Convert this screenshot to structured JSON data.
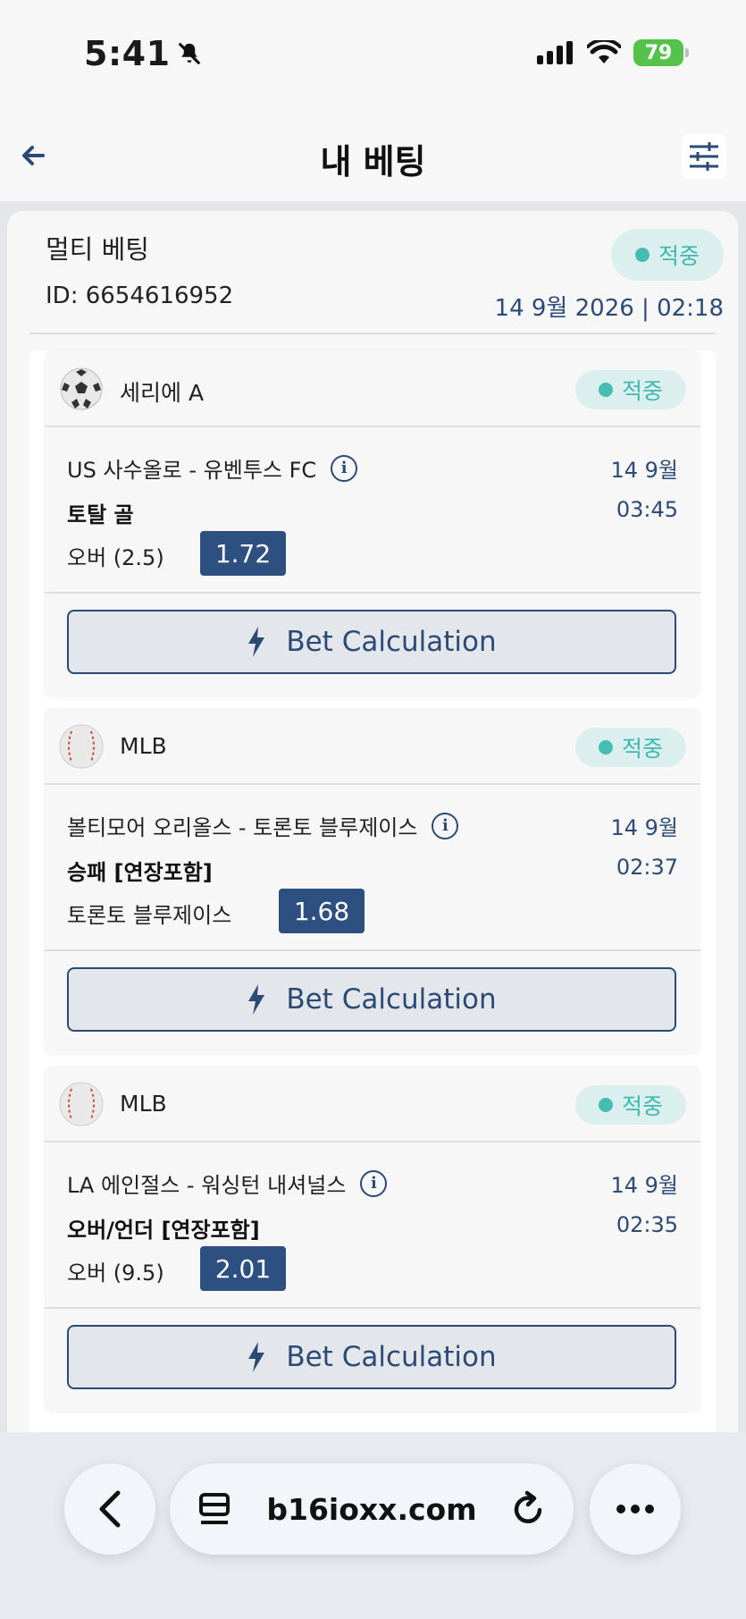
{
  "status_bar": {
    "time": "5:41",
    "battery": "79"
  },
  "header": {
    "title": "내 베팅"
  },
  "multi_bet": {
    "title": "멀티 베팅",
    "id": "ID: 6654616952",
    "status": "적중",
    "date": "14 9월 2026 | 02:18"
  },
  "bets": [
    {
      "league": "세리에 A",
      "sport_icon": "soccer-ball-icon",
      "status": "적중",
      "match": "US 사수올로 - 유벤투스 FC",
      "date": "14 9월",
      "market": "토탈 골",
      "time": "03:45",
      "selection": "오버 (2.5)",
      "odds": "1.72",
      "calc_label": "Bet Calculation"
    },
    {
      "league": "MLB",
      "sport_icon": "baseball-icon",
      "status": "적중",
      "match": "볼티모어 오리올스 - 토론토 블루제이스",
      "date": "14 9월",
      "market": "승패 [연장포함]",
      "time": "02:37",
      "selection": "토론토 블루제이스",
      "odds": "1.68",
      "calc_label": "Bet Calculation"
    },
    {
      "league": "MLB",
      "sport_icon": "baseball-icon",
      "status": "적중",
      "match": "LA 에인절스 - 워싱턴 내셔널스",
      "date": "14 9월",
      "market": "오버/언더 [연장포함]",
      "time": "02:35",
      "selection": "오버 (9.5)",
      "odds": "2.01",
      "calc_label": "Bet Calculation"
    }
  ],
  "browser": {
    "url": "b16ioxx.com"
  },
  "colors": {
    "accent": "#2e5080",
    "status": "#46bdb3"
  }
}
